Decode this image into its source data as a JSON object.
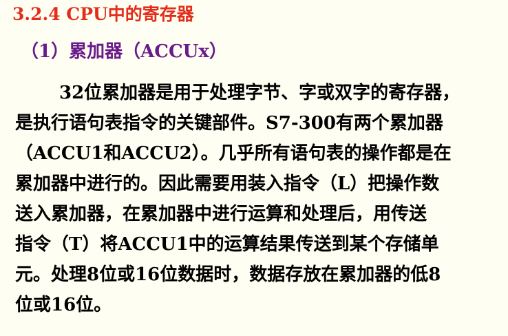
{
  "colors": {
    "background": "#FFFEF2",
    "heading": "#E32D1B",
    "subheading": "#6A1B8A",
    "body": "#000000"
  },
  "heading": {
    "text": "3.2.4 CPU中的寄存器"
  },
  "subheading": {
    "text": "（1）累加器（ACCUx）"
  },
  "paragraph": {
    "lines": [
      "32位累加器是用于处理字节、字或双字的寄存器，",
      "是执行语句表指令的关键部件。S7-300有两个累加器",
      "（ACCU1和ACCU2）。几乎所有语句表的操作都是在",
      "累加器中进行的。因此需要用装入指令（L）把操作数",
      "送入累加器，在累加器中进行运算和处理后，用传送",
      "指令（T）将ACCU1中的运算结果传送到某个存储单",
      "元。处理8位或16位数据时，数据存放在累加器的低8",
      "位或16位。"
    ]
  }
}
